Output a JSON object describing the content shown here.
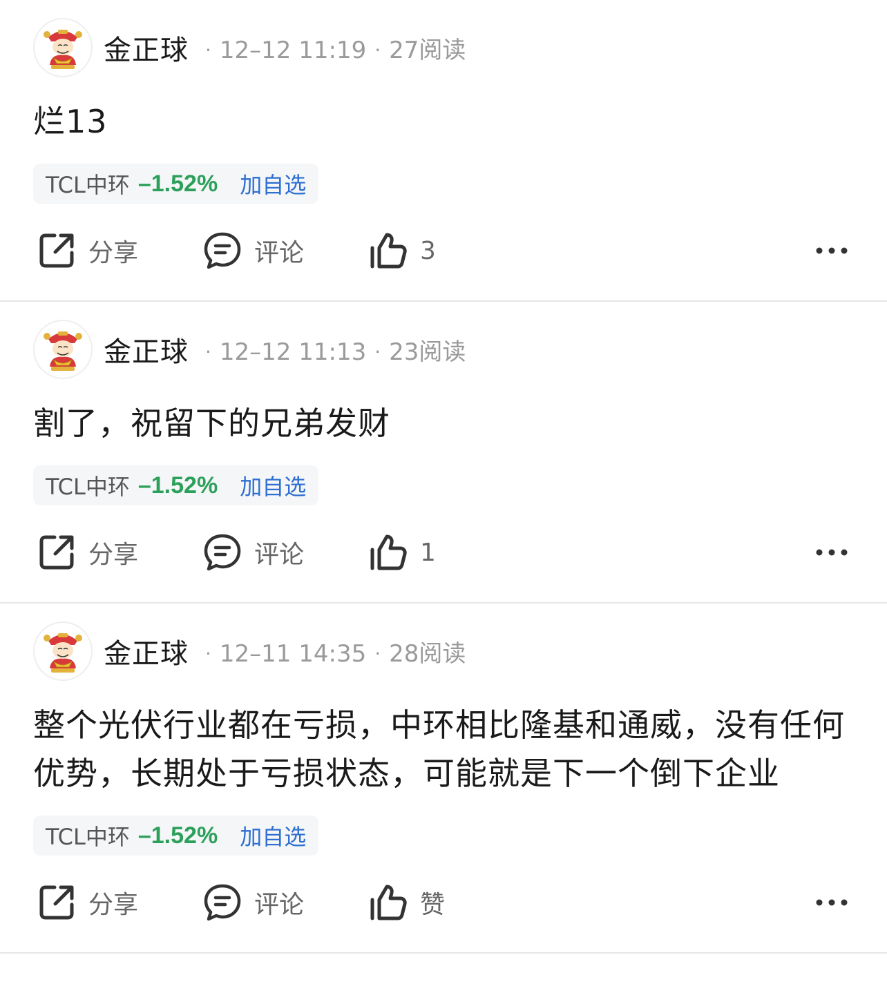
{
  "posts": [
    {
      "author": "金正球",
      "time": "12–12 11:19",
      "reads": "27阅读",
      "content": "烂13",
      "stock": {
        "name": "TCL中环",
        "change": "–1.52%",
        "add": "加自选"
      },
      "actions": {
        "share": "分享",
        "comment": "评论",
        "like": "3"
      }
    },
    {
      "author": "金正球",
      "time": "12–12 11:13",
      "reads": "23阅读",
      "content": "割了，祝留下的兄弟发财",
      "stock": {
        "name": "TCL中环",
        "change": "–1.52%",
        "add": "加自选"
      },
      "actions": {
        "share": "分享",
        "comment": "评论",
        "like": "1"
      }
    },
    {
      "author": "金正球",
      "time": "12–11 14:35",
      "reads": "28阅读",
      "content": "整个光伏行业都在亏损，中环相比隆基和通威，没有任何优势，长期处于亏损状态，可能就是下一个倒下企业",
      "stock": {
        "name": "TCL中环",
        "change": "–1.52%",
        "add": "加自选"
      },
      "actions": {
        "share": "分享",
        "comment": "评论",
        "like": "赞"
      }
    }
  ],
  "colors": {
    "stock_down": "#2ca05a",
    "link": "#2f6fd1",
    "meta": "#9a9a9a"
  },
  "icons": [
    "avatar-caishen-icon",
    "share-icon",
    "comment-icon",
    "thumbs-up-icon",
    "more-icon"
  ]
}
